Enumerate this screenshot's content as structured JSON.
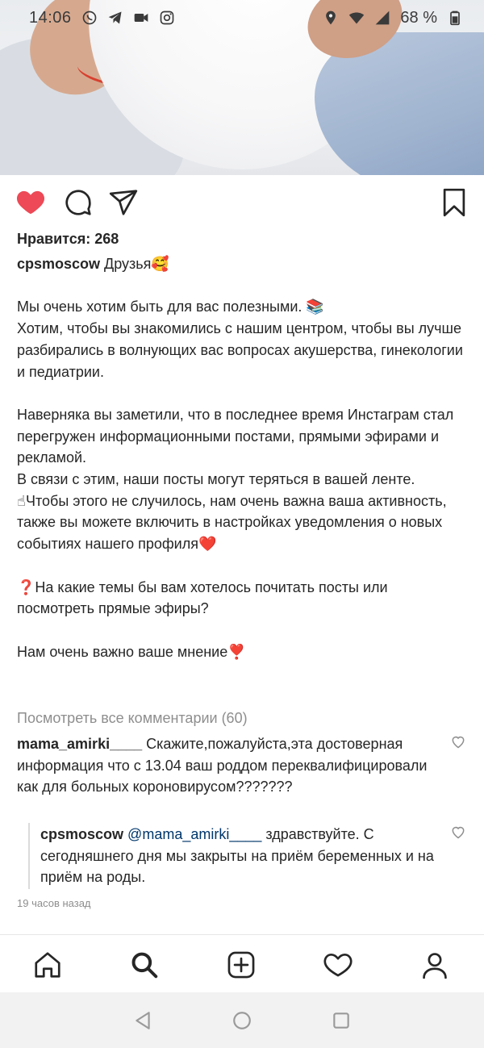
{
  "status_bar": {
    "time": "14:06",
    "battery": "68 %",
    "app_icons": [
      "whatsapp-icon",
      "telegram-icon",
      "video-icon",
      "instagram-icon"
    ],
    "system_icons": [
      "location-icon",
      "wifi-icon",
      "signal-icon",
      "battery-icon"
    ]
  },
  "post": {
    "likes_text": "Нравится: 268",
    "author": "cpsmoscow",
    "caption_first": " Друзья🥰",
    "caption_body": "\nМы очень хотим быть для вас полезными. 📚\nХотим, чтобы вы знакомились с нашим центром, чтобы вы лучше разбирались в волнующих вас вопросах акушерства, гинекологии и педиатрии.\n\nНаверняка вы заметили, что в последнее время Инстаграм стал перегружен информационными постами, прямыми эфирами и рекламой.\nВ связи с этим, наши посты могут теряться в вашей ленте.\n☝Чтобы этого не случилось, нам очень важна ваша активность, также вы можете включить в настройках уведомления о новых событиях нашего профиля❤️\n\n❓На какие темы бы вам хотелось почитать посты или посмотреть прямые эфиры?\n\nНам очень важно ваше мнение❣️",
    "liked": true
  },
  "comments": {
    "view_all": "Посмотреть все комментарии (60)",
    "items": [
      {
        "user": "mama_amirki____",
        "text": " Скажите,пожалуйста,эта достоверная информация что с 13.04 ваш роддом переквалифицировали как для больных короновирусом???????"
      },
      {
        "user": "cpsmoscow",
        "mention": " @mama_amirki____",
        "text": " здравствуйте. С сегодняшнего дня мы закрыты на приём беременных и на приём на роды."
      }
    ],
    "time_ago": "19 часов назад"
  },
  "colors": {
    "like_red": "#ed4956",
    "text": "#262626",
    "muted": "#8e8e8e",
    "mention": "#00376b"
  },
  "bottom_nav": [
    "home-icon",
    "search-icon",
    "add-post-icon",
    "activity-heart-icon",
    "profile-icon"
  ],
  "system_nav": [
    "back-icon",
    "home-circle-icon",
    "recents-icon"
  ]
}
